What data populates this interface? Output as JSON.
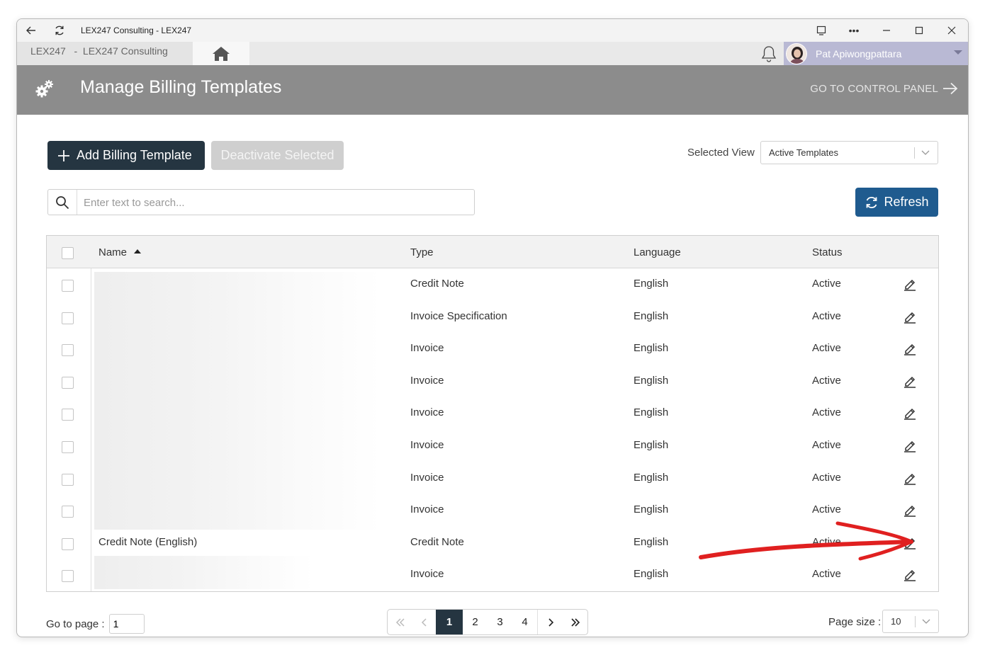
{
  "window": {
    "title": "LEX247 Consulting - LEX247"
  },
  "appbar": {
    "breadcrumb": "LEX247   -  LEX247 Consulting",
    "user_name": "Pat Apiwongpattara"
  },
  "header": {
    "title": "Manage Billing Templates",
    "control_panel_link": "GO TO CONTROL PANEL"
  },
  "toolbar": {
    "add_label": "Add Billing Template",
    "deactivate_label": "Deactivate Selected",
    "selected_view_label": "Selected View",
    "selected_view_value": "Active Templates",
    "refresh_label": "Refresh"
  },
  "search": {
    "placeholder": "Enter text to search..."
  },
  "table": {
    "columns": [
      "Name",
      "Type",
      "Language",
      "Status"
    ],
    "sort_column": "Name",
    "sort_direction": "ascending",
    "rows": [
      {
        "name": "",
        "type": "Credit Note",
        "language": "English",
        "status": "Active"
      },
      {
        "name": "",
        "type": "Invoice Specification",
        "language": "English",
        "status": "Active"
      },
      {
        "name": "",
        "type": "Invoice",
        "language": "English",
        "status": "Active"
      },
      {
        "name": "",
        "type": "Invoice",
        "language": "English",
        "status": "Active"
      },
      {
        "name": "",
        "type": "Invoice",
        "language": "English",
        "status": "Active"
      },
      {
        "name": "",
        "type": "Invoice",
        "language": "English",
        "status": "Active"
      },
      {
        "name": "",
        "type": "Invoice",
        "language": "English",
        "status": "Active"
      },
      {
        "name": "",
        "type": "Invoice",
        "language": "English",
        "status": "Active"
      },
      {
        "name": "Credit Note (English)",
        "type": "Credit Note",
        "language": "English",
        "status": "Active"
      },
      {
        "name": "",
        "type": "Invoice",
        "language": "English",
        "status": "Active"
      }
    ]
  },
  "pagination": {
    "goto_label": "Go to page :",
    "goto_value": "1",
    "pages": [
      "1",
      "2",
      "3",
      "4"
    ],
    "current_page": "1",
    "page_size_label": "Page size :",
    "page_size_value": "10"
  },
  "colors": {
    "header_bg": "#8c8c8c",
    "primary_dark": "#253541",
    "refresh_blue": "#1f5b8f",
    "user_bar": "#b9b9d4",
    "annotation_red": "#e02020"
  }
}
